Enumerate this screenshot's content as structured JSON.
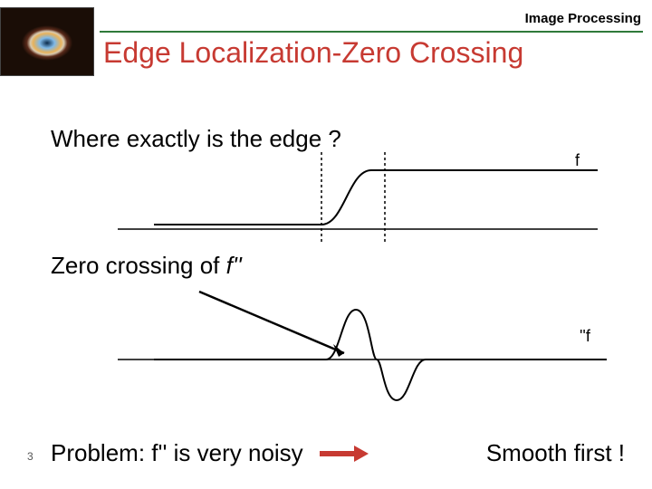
{
  "header": {
    "label": "Image Processing"
  },
  "title": "Edge Localization-Zero Crossing",
  "question": "Where exactly is the edge ?",
  "zero_crossing_prefix": "Zero crossing of ",
  "zero_crossing_symbol": "f''",
  "problem": "Problem: f'' is very noisy",
  "smooth": "Smooth first !",
  "slide_number": "3",
  "labels": {
    "f": "f",
    "fpp": "''f"
  },
  "chart_data": [
    {
      "type": "line",
      "title": "f",
      "xlabel": "",
      "ylabel": "",
      "x_range": [
        -5,
        5
      ],
      "series": [
        {
          "name": "f",
          "x": [
            -5,
            -2,
            -1.5,
            -1,
            -0.5,
            0,
            0.5,
            1,
            1.5,
            2,
            5
          ],
          "y": [
            0,
            0,
            0.05,
            0.15,
            0.35,
            0.6,
            0.82,
            0.93,
            0.98,
            1,
            1
          ]
        }
      ],
      "annotations": [
        "vertical dashed lines at x≈-1.5 and x≈1.5 bounding the transition zone"
      ]
    },
    {
      "type": "line",
      "title": "f''",
      "xlabel": "",
      "ylabel": "",
      "x_range": [
        -5,
        5
      ],
      "series": [
        {
          "name": "f''",
          "x": [
            -5,
            -1.5,
            -1,
            -0.6,
            -0.2,
            0,
            0.2,
            0.6,
            1,
            1.5,
            5
          ],
          "y": [
            0,
            0,
            0.25,
            0.9,
            0.5,
            0,
            -0.5,
            -0.9,
            -0.25,
            0,
            0
          ]
        }
      ],
      "annotations": [
        "arrow from upper-left pointing to the zero-crossing at x=0"
      ]
    }
  ]
}
